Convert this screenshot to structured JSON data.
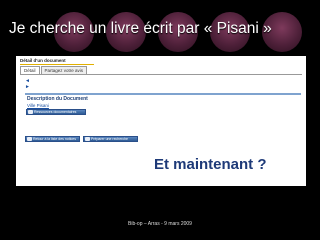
{
  "slide": {
    "title": "Je cherche un livre écrit par « Pisani »",
    "question": "Et maintenant ?",
    "footer": "Bib-op – Arras - 9 mars 2009"
  },
  "screenshot": {
    "header": "Détail d'un document",
    "tabs": [
      {
        "label": "Détail",
        "active": true
      },
      {
        "label": "Partagez votre avis",
        "active": false
      }
    ],
    "panel_title": "Description du Document",
    "author_link": "Ville Pisani",
    "buttons": {
      "resource": "Ressources documentaires",
      "back": "Retour à la liste des notices",
      "prepare": "Préparer une recherche"
    }
  },
  "colors": {
    "background": "#000000",
    "title_text": "#ffffff",
    "question_text": "#1e3a78",
    "panel_border": "#7fa3cf",
    "button": "#2d5a94"
  }
}
